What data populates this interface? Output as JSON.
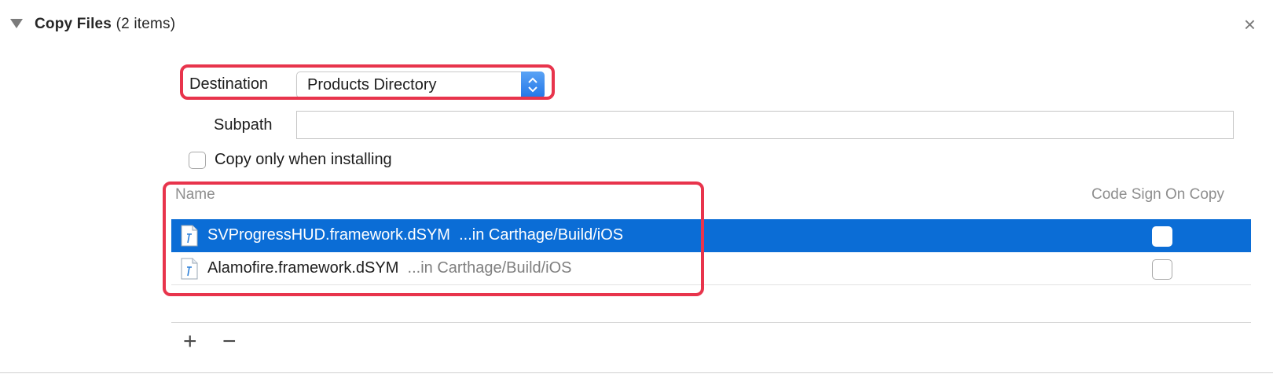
{
  "section": {
    "title": "Copy Files",
    "count": "(2 items)",
    "close_glyph": "×"
  },
  "destination": {
    "label": "Destination",
    "value": "Products Directory"
  },
  "subpath": {
    "label": "Subpath",
    "value": ""
  },
  "copy_only_when_installing": {
    "label": "Copy only when installing",
    "checked": false
  },
  "table": {
    "headers": {
      "name": "Name",
      "code_sign": "Code Sign On Copy"
    },
    "rows": [
      {
        "name": "SVProgressHUD.framework.dSYM",
        "location": "...in Carthage/Build/iOS",
        "selected": true,
        "code_sign": false,
        "icon": "dsym-file-icon"
      },
      {
        "name": "Alamofire.framework.dSYM",
        "location": "...in Carthage/Build/iOS",
        "selected": false,
        "code_sign": false,
        "icon": "dsym-file-icon"
      }
    ]
  },
  "toolbar": {
    "add_glyph": "+",
    "remove_glyph": "−"
  },
  "colors": {
    "selection": "#0b6dd6",
    "highlight_box": "#e8344c"
  }
}
